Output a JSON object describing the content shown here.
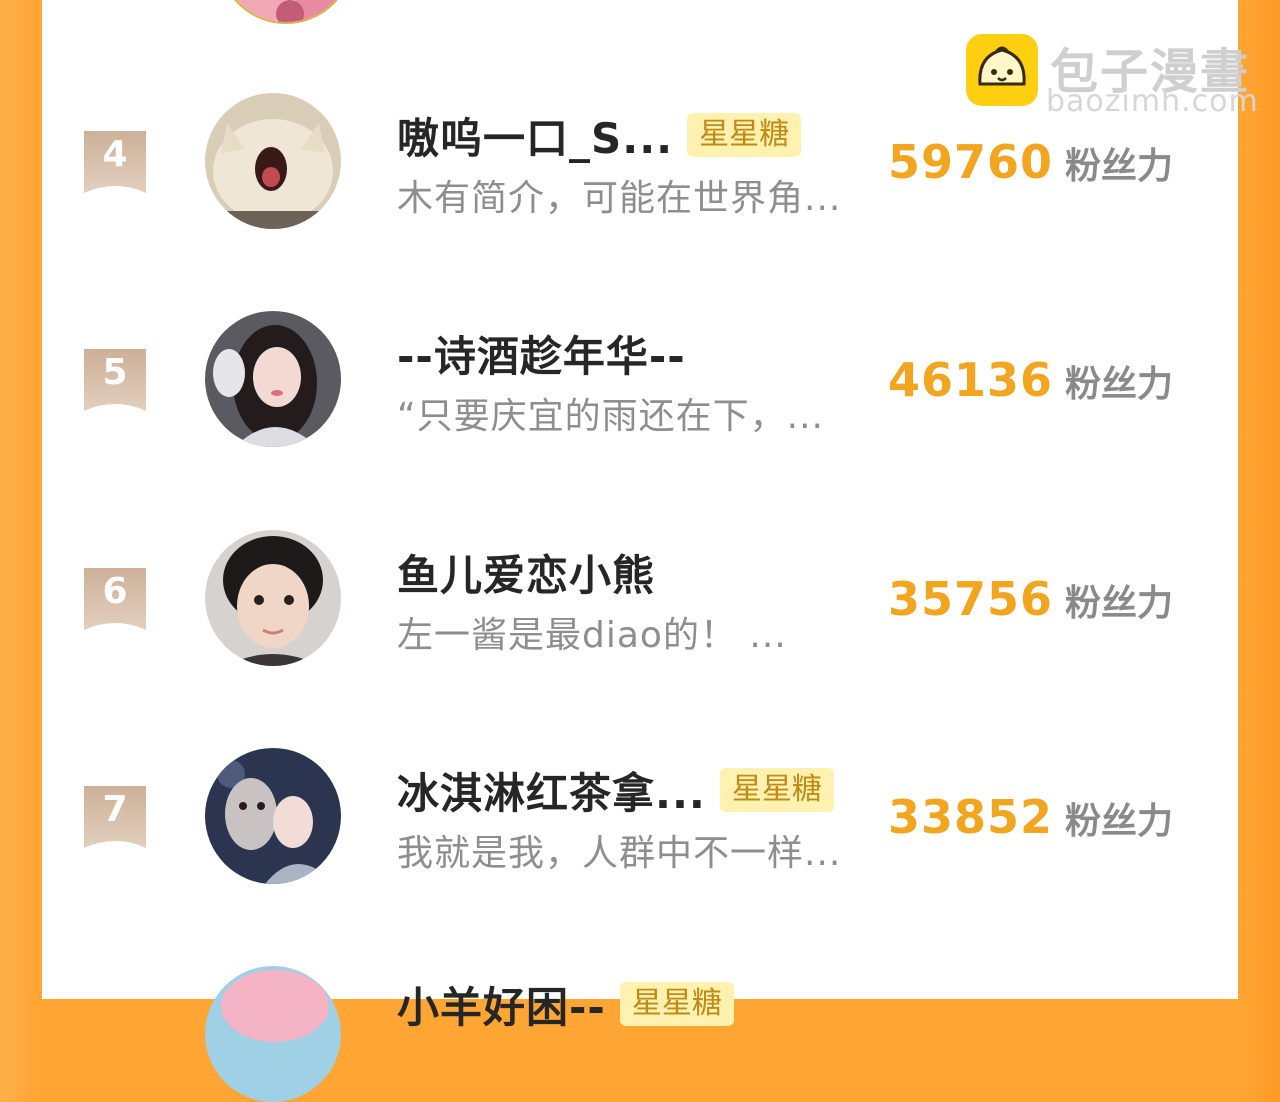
{
  "watermark": {
    "title": "包子漫畫",
    "url": "baozimh.com"
  },
  "colors": {
    "accent": "#f2a51f",
    "background": "#ffa534",
    "tag_bg": "#fff1b0",
    "tag_text": "#c18a15",
    "rank_badge": "#c9ab90"
  },
  "ranking": [
    {
      "rank": "4",
      "name": "嗷呜一口_S...",
      "tag": "星星糖",
      "bio": "木有简介，可能在世界角...",
      "fans": "59760",
      "fans_unit": "粉丝力",
      "avatar_icon": "cat-avatar"
    },
    {
      "rank": "5",
      "name": "--诗酒趁年华--",
      "tag": "",
      "bio": "“只要庆宜的雨还在下，...",
      "fans": "46136",
      "fans_unit": "粉丝力",
      "avatar_icon": "girl-headphones-avatar"
    },
    {
      "rank": "6",
      "name": "鱼儿爱恋小熊",
      "tag": "",
      "bio": "左一酱是最diao的！ ...",
      "fans": "35756",
      "fans_unit": "粉丝力",
      "avatar_icon": "boy-avatar"
    },
    {
      "rank": "7",
      "name": "冰淇淋红茶拿...",
      "tag": "星星糖",
      "bio": "我就是我，人群中不一样...",
      "fans": "33852",
      "fans_unit": "粉丝力",
      "avatar_icon": "mask-girl-avatar"
    }
  ],
  "next_row": {
    "name": "小羊好困--",
    "tag": "星星糖"
  }
}
